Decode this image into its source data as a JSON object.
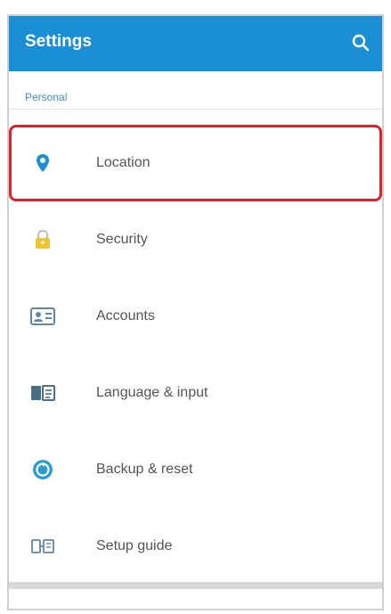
{
  "app_bar": {
    "title": "Settings",
    "color": "#1a8fd6",
    "search_icon": "search-icon"
  },
  "section": {
    "header": "Personal",
    "header_color": "#3a8ec4"
  },
  "items": [
    {
      "label": "Location",
      "icon": "location-icon",
      "highlighted": true
    },
    {
      "label": "Security",
      "icon": "lock-icon",
      "highlighted": false
    },
    {
      "label": "Accounts",
      "icon": "accounts-icon",
      "highlighted": false
    },
    {
      "label": "Language & input",
      "icon": "language-icon",
      "highlighted": false
    },
    {
      "label": "Backup & reset",
      "icon": "backup-icon",
      "highlighted": false
    },
    {
      "label": "Setup guide",
      "icon": "setup-guide-icon",
      "highlighted": false
    }
  ],
  "highlight_color": "#d9232d"
}
